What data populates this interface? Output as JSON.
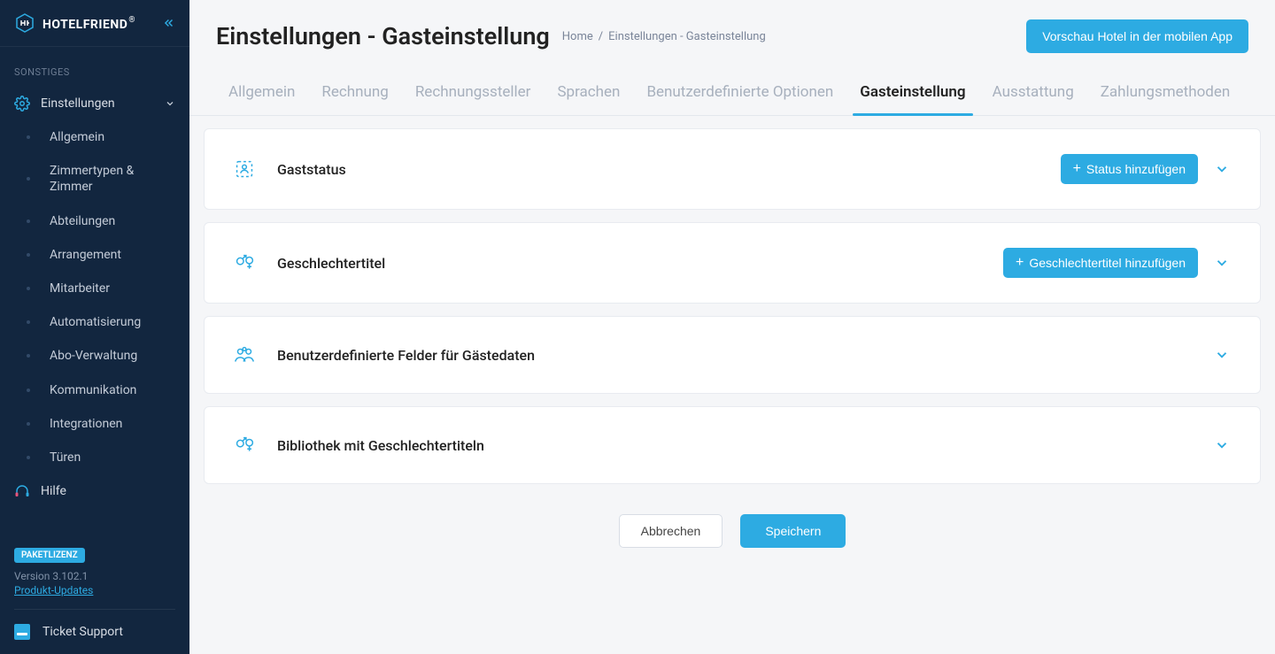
{
  "brand": {
    "name": "HOTELFRIEND",
    "reg": "®"
  },
  "sidebar": {
    "section_label": "SONSTIGES",
    "settings_label": "Einstellungen",
    "items": [
      {
        "label": "Allgemein"
      },
      {
        "label": "Zimmertypen & Zimmer"
      },
      {
        "label": "Abteilungen"
      },
      {
        "label": "Arrangement"
      },
      {
        "label": "Mitarbeiter"
      },
      {
        "label": "Automatisierung"
      },
      {
        "label": "Abo-Verwaltung"
      },
      {
        "label": "Kommunikation"
      },
      {
        "label": "Integrationen"
      },
      {
        "label": "Türen"
      }
    ],
    "help_label": "Hilfe",
    "license_badge": "PAKETLIZENZ",
    "version": "Version 3.102.1",
    "product_updates": "Produkt-Updates",
    "ticket_support": "Ticket Support"
  },
  "header": {
    "title": "Einstellungen - Gasteinstellung",
    "breadcrumb_home": "Home",
    "breadcrumb_sep": "/",
    "breadcrumb_current": "Einstellungen - Gasteinstellung",
    "preview_btn": "Vorschau Hotel in der mobilen App"
  },
  "tabs": [
    {
      "label": "Allgemein"
    },
    {
      "label": "Rechnung"
    },
    {
      "label": "Rechnungssteller"
    },
    {
      "label": "Sprachen"
    },
    {
      "label": "Benutzerdefinierte Optionen"
    },
    {
      "label": "Gasteinstellung"
    },
    {
      "label": "Ausstattung"
    },
    {
      "label": "Zahlungsmethoden"
    }
  ],
  "panels": {
    "guest_status": {
      "title": "Gaststatus",
      "add_label": "Status hinzufügen"
    },
    "gender_title": {
      "title": "Geschlechtertitel",
      "add_label": "Geschlechtertitel hinzufügen"
    },
    "custom_fields": {
      "title": "Benutzerdefinierte Felder für Gästedaten"
    },
    "gender_library": {
      "title": "Bibliothek mit Geschlechtertiteln"
    }
  },
  "footer": {
    "cancel": "Abbrechen",
    "save": "Speichern"
  }
}
